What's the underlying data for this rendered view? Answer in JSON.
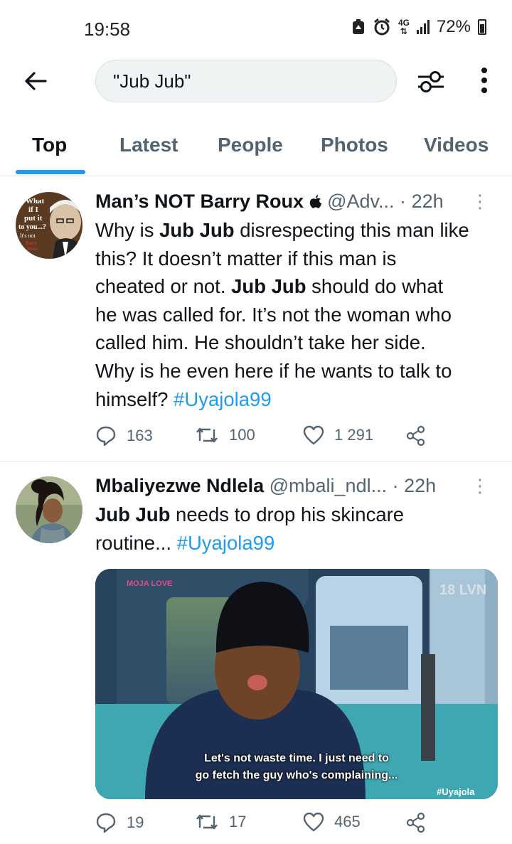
{
  "status_bar": {
    "time": "19:58",
    "network": "4G",
    "battery": "72%",
    "icons": [
      "battery-saver-icon",
      "alarm-icon",
      "signal-icon",
      "battery-icon"
    ]
  },
  "header": {
    "search_value": "\"Jub Jub\"",
    "icons": [
      "back-arrow-icon",
      "filter-sliders-icon",
      "more-vertical-icon"
    ]
  },
  "tabs": [
    {
      "label": "Top",
      "active": true
    },
    {
      "label": "Latest",
      "active": false
    },
    {
      "label": "People",
      "active": false
    },
    {
      "label": "Photos",
      "active": false
    },
    {
      "label": "Videos",
      "active": false
    }
  ],
  "tweets": [
    {
      "name": "Man’s NOT Barry Roux",
      "verified_glyph": "apple-icon",
      "handle": "@Adv...",
      "dot": "·",
      "time": "22h",
      "avatar_text": [
        "What",
        "if I",
        "put it",
        "to you...?",
        "It's not",
        "Barry",
        "Roux"
      ],
      "text_lines": [
        [
          "Why is ",
          "Jub Jub",
          " disrespecting this man like"
        ],
        [
          "this? It doesn’t matter if this man is"
        ],
        [
          "cheated or not. ",
          "Jub Jub",
          " should do what"
        ],
        [
          "he was called for. It’s not the woman who"
        ],
        [
          "called him. He shouldn’t take her side."
        ],
        [
          "Why is he even here if he wants to talk to"
        ],
        [
          "himself? ",
          "#Uyajola99"
        ]
      ],
      "replies": "163",
      "retweets": "100",
      "likes": "1 291"
    },
    {
      "name": "Mbaliyezwe Ndlela",
      "handle": "@mbali_ndl...",
      "dot": "·",
      "time": "22h",
      "text_lines": [
        [
          "Jub Jub",
          " needs to drop his skincare"
        ],
        [
          "routine... ",
          "#Uyajola99"
        ]
      ],
      "media": {
        "logo": "MOJA LOVE",
        "corner_tag": "18 LVN",
        "subtitle_line1": "Let's not waste time. I just need to",
        "subtitle_line2": "go fetch the guy who's complaining...",
        "watermark": "#Uyajola"
      },
      "replies": "19",
      "retweets": "17",
      "likes": "465"
    }
  ],
  "colors": {
    "accent": "#1d9bf0",
    "text_primary": "#0f1419",
    "text_secondary": "#536471",
    "divider": "#dfe3e6"
  }
}
